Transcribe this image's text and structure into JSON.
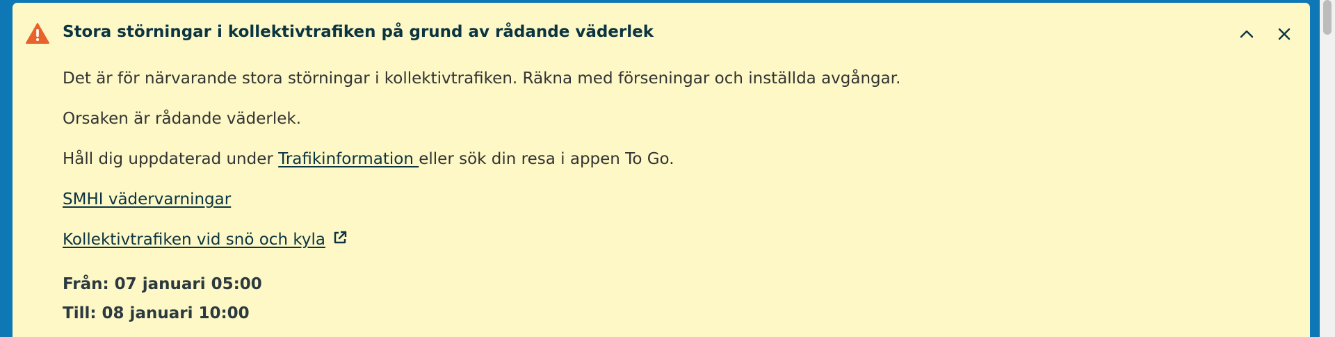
{
  "alert": {
    "title": "Stora störningar i kollektivtrafiken på grund av rådande väderlek",
    "paragraph1": "Det är för närvarande stora störningar i kollektivtrafiken. Räkna med förseningar och inställda avgångar.",
    "paragraph2": "Orsaken är rådande väderlek.",
    "paragraph3_before": "Håll dig uppdaterad under ",
    "paragraph3_link": "Trafikinformation ",
    "paragraph3_after": "eller sök din resa i appen To Go.",
    "link_smhi": "SMHI vädervarningar",
    "link_snow": "Kollektivtrafiken vid snö och kyla",
    "from": "Från: 07 januari 05:00",
    "to": "Till: 08 januari 10:00"
  },
  "icons": {
    "warning": "warning-triangle-icon",
    "collapse": "chevron-up-icon",
    "close": "close-icon",
    "external": "external-link-icon"
  },
  "colors": {
    "page_background": "#0e77b6",
    "alert_background": "#fdf8c6",
    "warning": "#e8632b",
    "title": "#0b3442",
    "body_text": "#333333"
  }
}
